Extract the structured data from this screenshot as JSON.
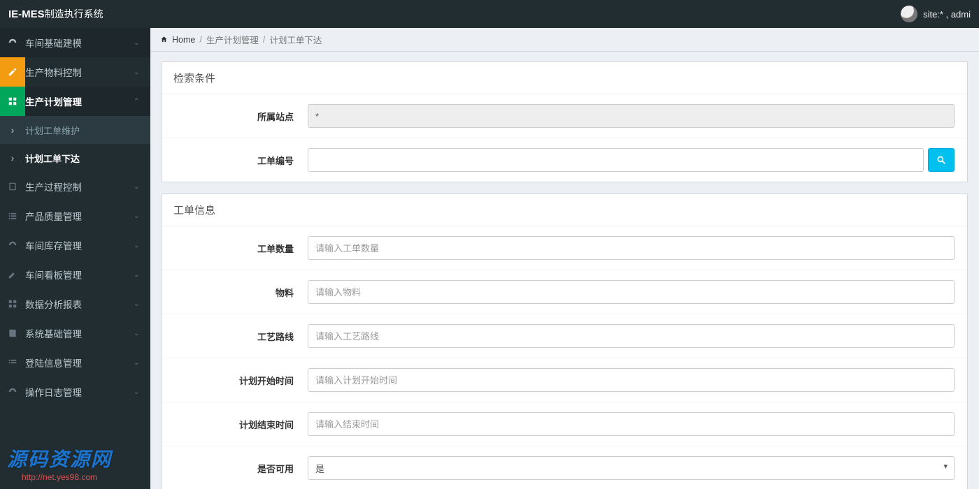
{
  "brand": {
    "strong": "IE-MES",
    "rest": "制造执行系统"
  },
  "user": {
    "site_label": "site:* , admi"
  },
  "breadcrumb": {
    "home": "Home",
    "a": "生产计划管理",
    "b": "计划工单下达"
  },
  "sidebar": {
    "items": [
      {
        "label": "车间基础建模",
        "icon": "dashboard"
      },
      {
        "label": "生产物料控制",
        "icon": "edit"
      },
      {
        "label": "生产计划管理",
        "icon": "grid",
        "active": true,
        "children": [
          {
            "label": "计划工单维护",
            "current": false
          },
          {
            "label": "计划工单下达",
            "current": true
          }
        ]
      },
      {
        "label": "生产过程控制",
        "icon": "book"
      },
      {
        "label": "产品质量管理",
        "icon": "list"
      },
      {
        "label": "车间库存管理",
        "icon": "dashboard"
      },
      {
        "label": "车间看板管理",
        "icon": "edit"
      },
      {
        "label": "数据分析报表",
        "icon": "grid"
      },
      {
        "label": "系统基础管理",
        "icon": "book"
      },
      {
        "label": "登陆信息管理",
        "icon": "list"
      },
      {
        "label": "操作日志管理",
        "icon": "dashboard"
      }
    ]
  },
  "panel_search": {
    "title": "检索条件",
    "site_label": "所属站点",
    "site_value": "*",
    "order_label": "工单编号"
  },
  "panel_info": {
    "title": "工单信息",
    "qty_label": "工单数量",
    "qty_ph": "请输入工单数量",
    "mat_label": "物料",
    "mat_ph": "请输入物料",
    "route_label": "工艺路线",
    "route_ph": "请输入工艺路线",
    "start_label": "计划开始时间",
    "start_ph": "请输入计划开始时间",
    "end_label": "计划结束时间",
    "end_ph": "请输入结束时间",
    "enable_label": "是否可用",
    "enable_value": "是"
  },
  "watermark": {
    "t1": "源码资源网",
    "t2": "http://net.yes98.com"
  }
}
